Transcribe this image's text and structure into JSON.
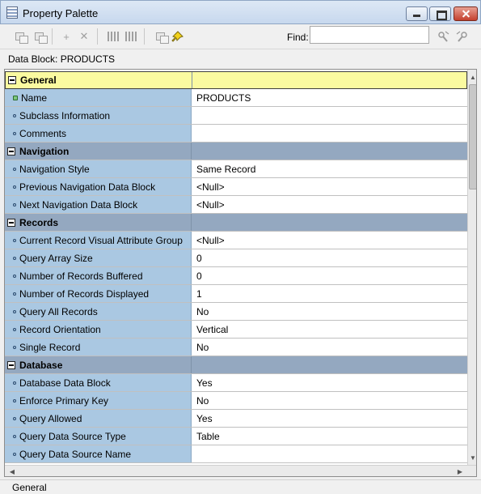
{
  "window": {
    "title": "Property Palette"
  },
  "toolbar": {
    "find_label": "Find:",
    "find_value": ""
  },
  "header": {
    "block_label": "Data Block: PRODUCTS"
  },
  "groups": [
    {
      "label": "General",
      "rows": [
        {
          "name": "Name",
          "value": "PRODUCTS"
        },
        {
          "name": "Subclass Information",
          "value": ""
        },
        {
          "name": "Comments",
          "value": ""
        }
      ]
    },
    {
      "label": "Navigation",
      "rows": [
        {
          "name": "Navigation Style",
          "value": "Same Record"
        },
        {
          "name": "Previous Navigation Data Block",
          "value": "<Null>"
        },
        {
          "name": "Next Navigation Data Block",
          "value": "<Null>"
        }
      ]
    },
    {
      "label": "Records",
      "rows": [
        {
          "name": "Current Record Visual Attribute Group",
          "value": "<Null>"
        },
        {
          "name": "Query Array Size",
          "value": "0"
        },
        {
          "name": "Number of Records Buffered",
          "value": "0"
        },
        {
          "name": "Number of Records Displayed",
          "value": "1"
        },
        {
          "name": "Query All Records",
          "value": "No"
        },
        {
          "name": "Record Orientation",
          "value": "Vertical"
        },
        {
          "name": "Single Record",
          "value": "No"
        }
      ]
    },
    {
      "label": "Database",
      "rows": [
        {
          "name": "Database Data Block",
          "value": "Yes"
        },
        {
          "name": "Enforce Primary Key",
          "value": "No"
        },
        {
          "name": "Query Allowed",
          "value": "Yes"
        },
        {
          "name": "Query Data Source Type",
          "value": "Table"
        },
        {
          "name": "Query Data Source Name",
          "value": ""
        }
      ]
    }
  ],
  "status": {
    "text": "General"
  }
}
